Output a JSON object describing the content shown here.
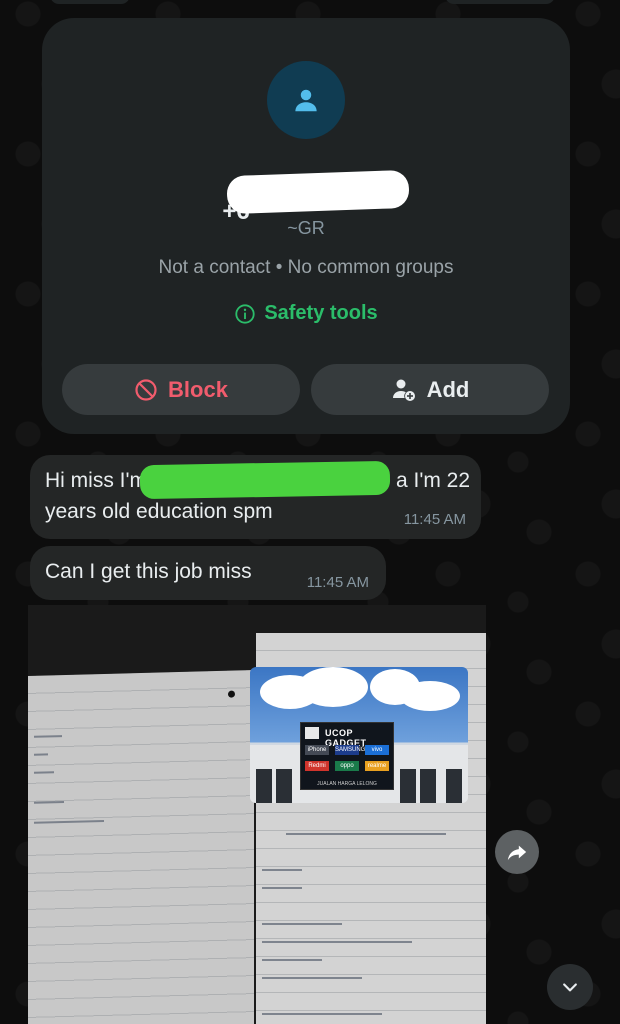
{
  "contact_card": {
    "phone_prefix": "+6",
    "alias": "~GR",
    "info_line": "Not a contact • No common groups",
    "safety_tools_label": "Safety tools",
    "block_label": "Block",
    "add_label": "Add"
  },
  "messages": [
    {
      "text_start": "Hi miss I'm",
      "text_end": "a I'm 22",
      "text_line2": "years old education spm",
      "time": "11:45 AM"
    },
    {
      "text": "Can I get this job miss",
      "time": "11:45 AM"
    }
  ],
  "photo": {
    "sign_title": "UCOP GADGET",
    "brands": [
      "iPhone",
      "SAMSUNG",
      "vivo",
      "Redmi",
      "oppo",
      "realme"
    ],
    "sign_footer": "JUALAN HARGA LELONG"
  },
  "colors": {
    "block_red": "#f15c6d",
    "safety_green": "#2bbd6a",
    "bubble_bg": "#242626",
    "card_bg": "#1f2324",
    "avatar_bg": "#103c52"
  }
}
